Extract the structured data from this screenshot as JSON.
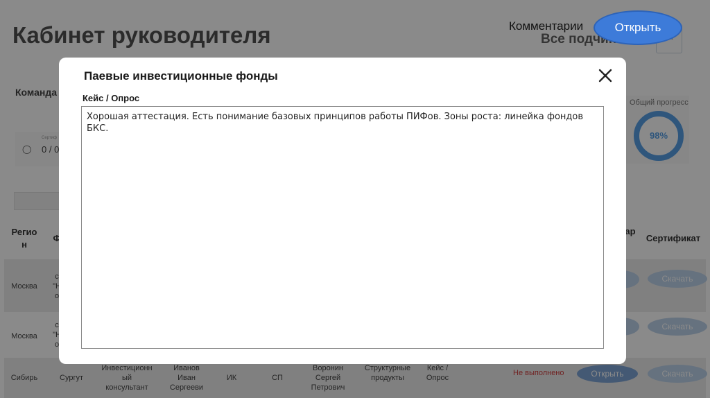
{
  "header": {
    "title": "Кабинет руководителя",
    "subordinates": "Все подчиненные",
    "more_button": "...",
    "comments_label": "Комментарии",
    "open_button": "Открыть"
  },
  "dashboard": {
    "team_tab": "Команда",
    "card_small_label": "Сертиф",
    "card_value": "0 / 0",
    "progress_label": "Общий прогресс",
    "progress_value": "98%",
    "progress_fraction": 0.98
  },
  "table": {
    "headers": {
      "region": "Регио\nн",
      "col2": "Ф",
      "col_partial": "ар",
      "certificate": "Сертификат"
    },
    "rows": [
      {
        "region": "Москва",
        "col2": "с\n\"Н\nо",
        "download": "Скачать"
      },
      {
        "region": "Москва",
        "col2": "с\n\"Н\nо",
        "download": "Скачать"
      },
      {
        "region": "Сибирь",
        "city": "Сургут",
        "position": "Инвестиционн\nый\nконсультант",
        "name": "Иванов\nИван\nСергееви",
        "code1": "ИК",
        "code2": "СП",
        "manager": "Воронин\nСергей\nПетрович",
        "product": "Структурные\nпродукты",
        "type": "Кейс /\nОпрос",
        "status": "Не выполнено",
        "open": "Открыть",
        "download": "Скачать"
      }
    ]
  },
  "modal": {
    "title": "Паевые инвестиционные фонды",
    "field_label": "Кейс / Опрос",
    "comment": "Хорошая аттестация. Есть понимание базовых принципов работы ПИФов. Зоны роста: линейка фондов БКС."
  },
  "colors": {
    "accent": "#3d7bd9",
    "ring": "#58a0e6",
    "fail": "#d04040"
  }
}
